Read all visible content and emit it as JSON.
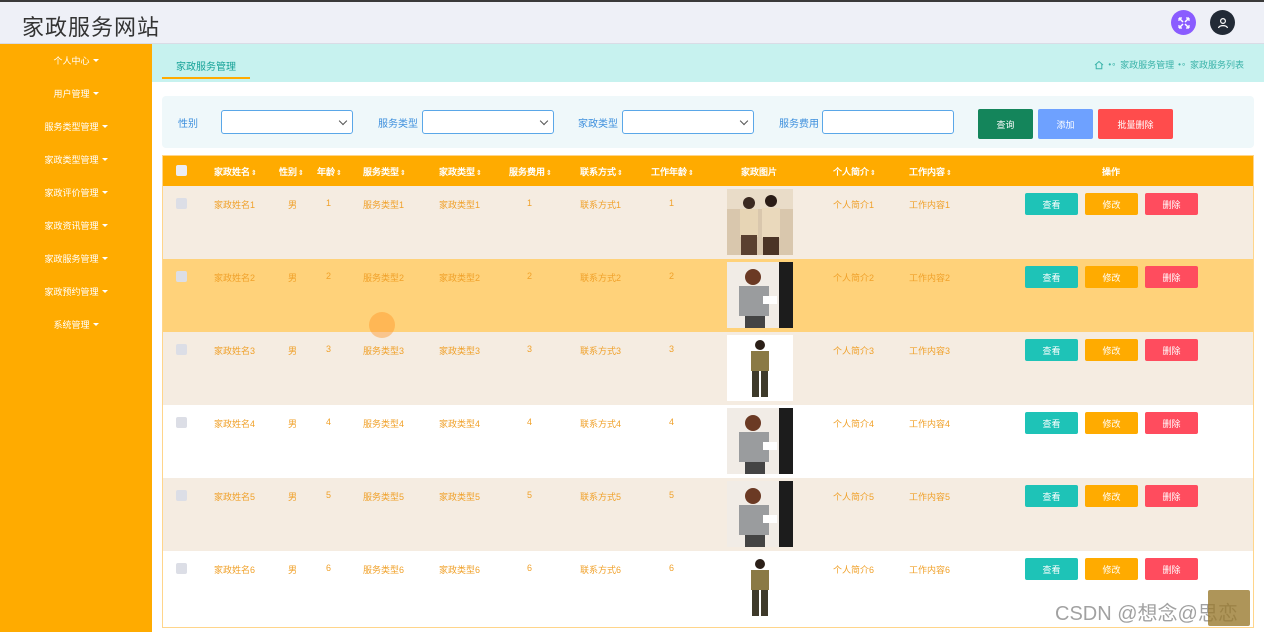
{
  "header": {
    "title": "家政服务网站"
  },
  "sidebar": {
    "items": [
      {
        "label": "个人中心"
      },
      {
        "label": "用户管理"
      },
      {
        "label": "服务类型管理"
      },
      {
        "label": "家政类型管理"
      },
      {
        "label": "家政评价管理"
      },
      {
        "label": "家政资讯管理"
      },
      {
        "label": "家政服务管理"
      },
      {
        "label": "家政预约管理"
      },
      {
        "label": "系统管理"
      }
    ]
  },
  "tabs": {
    "active": "家政服务管理"
  },
  "breadcrumb": {
    "level1": "家政服务管理",
    "level2": "家政服务列表"
  },
  "search": {
    "gender_label": "性别",
    "service_type_label": "服务类型",
    "housekeeping_type_label": "家政类型",
    "fee_label": "服务费用",
    "query_button": "查询",
    "add_button": "添加",
    "batch_delete_button": "批量删除"
  },
  "table": {
    "headers": {
      "name": "家政姓名",
      "gender": "性别",
      "age": "年龄",
      "service_type": "服务类型",
      "housekeeping_type": "家政类型",
      "fee": "服务费用",
      "contact": "联系方式",
      "years": "工作年龄",
      "photo": "家政图片",
      "intro": "个人简介",
      "work": "工作内容",
      "actions": "操作"
    },
    "sort_glyph": "⇕",
    "view_label": "查看",
    "edit_label": "修改",
    "delete_label": "删除",
    "rows": [
      {
        "name": "家政姓名1",
        "gender": "男",
        "age": "1",
        "service_type": "服务类型1",
        "housekeeping_type": "家政类型1",
        "fee": "1",
        "contact": "联系方式1",
        "years": "1",
        "intro": "个人简介1",
        "work": "工作内容1",
        "photo": "couple-uniform"
      },
      {
        "name": "家政姓名2",
        "gender": "男",
        "age": "2",
        "service_type": "服务类型2",
        "housekeeping_type": "家政类型2",
        "fee": "2",
        "contact": "联系方式2",
        "years": "2",
        "intro": "个人简介2",
        "work": "工作内容2",
        "photo": "woman-cleaning"
      },
      {
        "name": "家政姓名3",
        "gender": "男",
        "age": "3",
        "service_type": "服务类型3",
        "housekeeping_type": "家政类型3",
        "fee": "3",
        "contact": "联系方式3",
        "years": "3",
        "intro": "个人简介3",
        "work": "工作内容3",
        "photo": "man-uniform"
      },
      {
        "name": "家政姓名4",
        "gender": "男",
        "age": "4",
        "service_type": "服务类型4",
        "housekeeping_type": "家政类型4",
        "fee": "4",
        "contact": "联系方式4",
        "years": "4",
        "intro": "个人简介4",
        "work": "工作内容4",
        "photo": "woman-cleaning"
      },
      {
        "name": "家政姓名5",
        "gender": "男",
        "age": "5",
        "service_type": "服务类型5",
        "housekeeping_type": "家政类型5",
        "fee": "5",
        "contact": "联系方式5",
        "years": "5",
        "intro": "个人简介5",
        "work": "工作内容5",
        "photo": "woman-cleaning"
      },
      {
        "name": "家政姓名6",
        "gender": "男",
        "age": "6",
        "service_type": "服务类型6",
        "housekeeping_type": "家政类型6",
        "fee": "6",
        "contact": "联系方式6",
        "years": "6",
        "intro": "个人简介6",
        "work": "工作内容6",
        "photo": "man-uniform"
      }
    ]
  },
  "watermark": "CSDN @想念@思恋",
  "colors": {
    "sidebar": "#ffab00",
    "tabbar": "#c7f2ef",
    "row_odd": "#f5ece1",
    "row_hover": "#ffd27a",
    "row_even": "#ffffff",
    "view": "#1ec3b7",
    "edit": "#ffab00",
    "delete": "#ff4c5e"
  }
}
